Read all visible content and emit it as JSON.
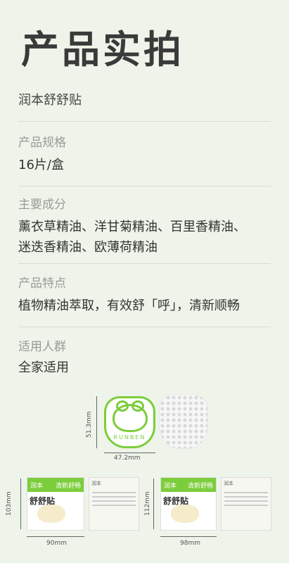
{
  "title": "产品实拍",
  "product_name": "润本舒舒贴",
  "sections": [
    {
      "label": "产品规格",
      "value": "16片/盒"
    },
    {
      "label": "主要成分",
      "value": "薰衣草精油、洋甘菊精油、百里香精油、迷迭香精油、欧薄荷精油"
    },
    {
      "label": "产品特点",
      "value": "植物精油萃取，有效舒「呼」，清新顺畅"
    },
    {
      "label": "适用人群",
      "value": "全家适用"
    }
  ],
  "sticker": {
    "brand": "RUNBEN",
    "height_label": "51.3mm",
    "width_label": "47.2mm"
  },
  "packs": [
    {
      "height_label": "103mm",
      "width_label": "90mm",
      "brand": "润本",
      "tagline": "清新舒畅",
      "name": "舒舒贴"
    },
    {
      "height_label": "112mm",
      "width_label": "98mm",
      "brand": "润本",
      "tagline": "清新舒畅",
      "name": "舒舒贴"
    }
  ]
}
